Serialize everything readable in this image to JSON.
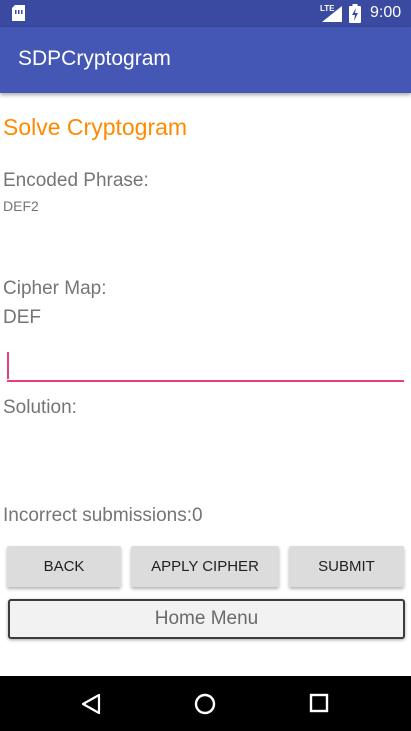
{
  "status_bar": {
    "network": "LTE",
    "time": "9:00"
  },
  "app_bar": {
    "title": "SDPCryptogram"
  },
  "main": {
    "screen_title": "Solve Cryptogram",
    "encoded_label": "Encoded Phrase:",
    "encoded_value": "DEF2",
    "cipher_label": "Cipher Map:",
    "cipher_value": "DEF",
    "cipher_input": {
      "value": "",
      "placeholder": ""
    },
    "solution_label": "Solution:",
    "solution_value": "",
    "incorrect_label": "Incorrect submissions:",
    "incorrect_count": "0"
  },
  "buttons": {
    "back": "BACK",
    "apply_cipher": "APPLY CIPHER",
    "submit": "SUBMIT",
    "home_menu": "Home Menu"
  },
  "nav_bar": {
    "icons": [
      "back-triangle-icon",
      "home-circle-icon",
      "recents-square-icon"
    ]
  },
  "colors": {
    "status_bar": "#3a4aa0",
    "app_bar": "#4557b5",
    "accent": "#ff8a00",
    "input_underline": "#e5407a",
    "button": "#dcdcdc"
  }
}
